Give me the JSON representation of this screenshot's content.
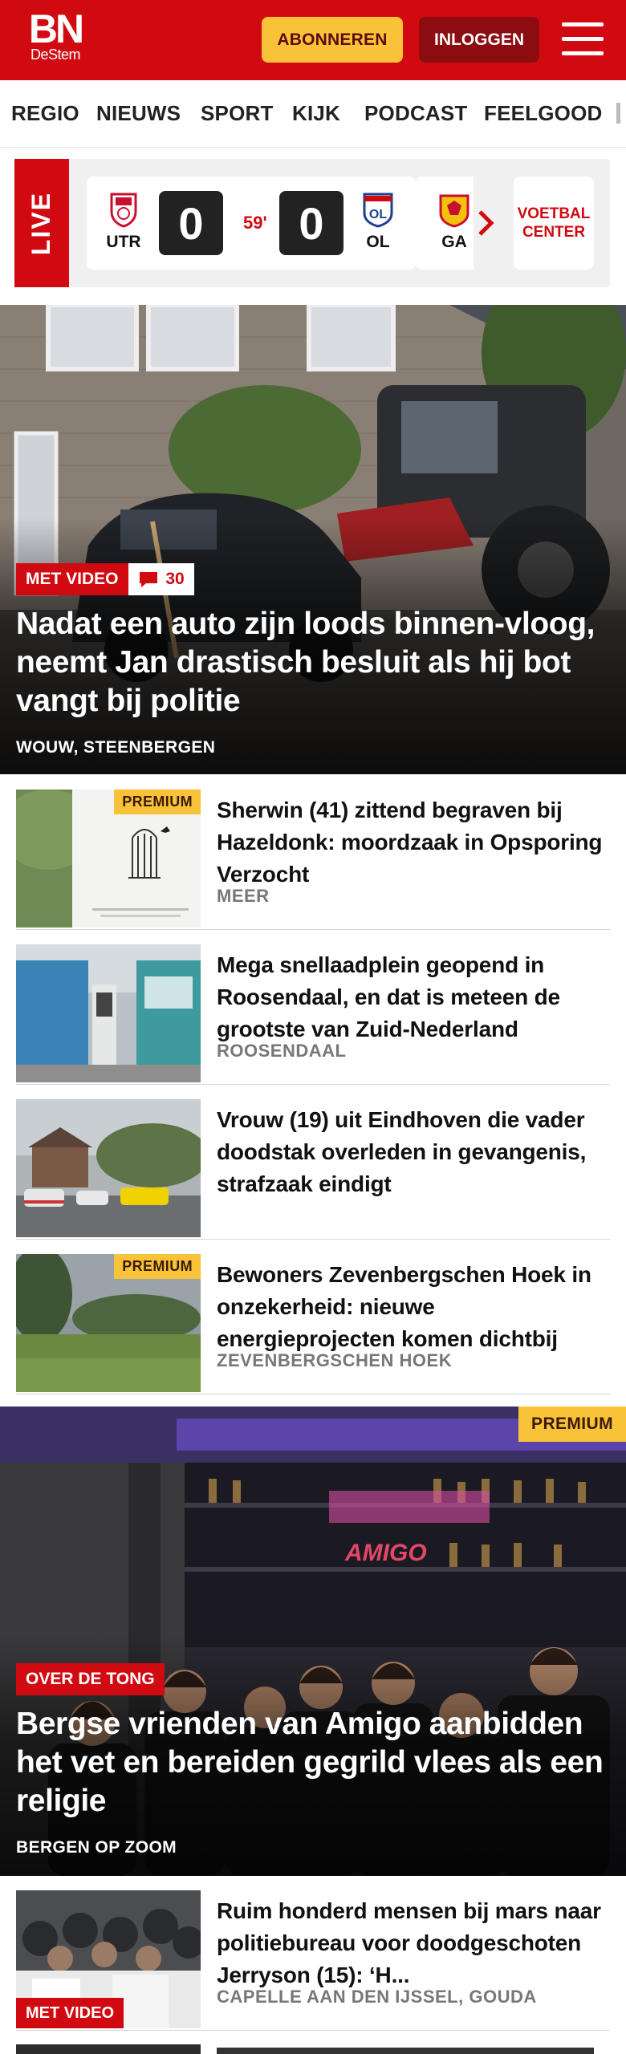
{
  "header": {
    "logo_main": "BN",
    "logo_sub": "DeStem",
    "subscribe_label": "ABONNEREN",
    "login_label": "INLOGGEN"
  },
  "nav": {
    "items": [
      "REGIO",
      "NIEUWS",
      "SPORT",
      "KIJK",
      "PODCAST",
      "FEELGOOD"
    ]
  },
  "live": {
    "label": "LIVE",
    "match": {
      "home": "UTR",
      "away": "OL",
      "home_score": "0",
      "away_score": "0",
      "minute": "59'"
    },
    "next_team": "GA",
    "voetbalcenter": "VOETBAL CENTER"
  },
  "hero": {
    "tag": "MET VIDEO",
    "comments": "30",
    "title": "Nadat een auto zijn loods binnen-vloog, neemt Jan drastisch besluit als hij bot vangt bij politie",
    "location": "WOUW, STEENBERGEN"
  },
  "articles": [
    {
      "premium": "PREMIUM",
      "title": "Sherwin (41) zittend begraven bij Hazeldonk: moordzaak in Opsporing Verzocht",
      "location": "MEER"
    },
    {
      "premium": "",
      "title": "Mega snellaadplein geopend in Roosendaal, en dat is meteen de grootste van Zuid-Nederland",
      "location": "ROOSENDAAL"
    },
    {
      "premium": "",
      "title": "Vrouw (19) uit Eindhoven die vader doodstak overleden in gevangenis, strafzaak eindigt",
      "location": ""
    },
    {
      "premium": "PREMIUM",
      "title": "Bewoners Zevenbergschen Hoek in onzekerheid: nieuwe energieprojecten komen dichtbij",
      "location": "ZEVENBERGSCHEN HOEK"
    }
  ],
  "feature": {
    "premium": "PREMIUM",
    "tag": "OVER DE TONG",
    "title": "Bergse vrienden van Amigo aanbidden het vet en bereiden gegrild vlees als een religie",
    "location": "BERGEN OP ZOOM",
    "sign_text": "AMIGO"
  },
  "article_last": {
    "tag": "MET VIDEO",
    "title": "Ruim honderd mensen bij mars naar politiebureau voor doodgeschoten Jerryson (15): ‘H...",
    "location": "CAPELLE AAN DEN IJSSEL, GOUDA"
  },
  "colors": {
    "brand_red": "#d10a11",
    "premium_yellow": "#f8c338",
    "login_dark_red": "#8c0c12"
  }
}
